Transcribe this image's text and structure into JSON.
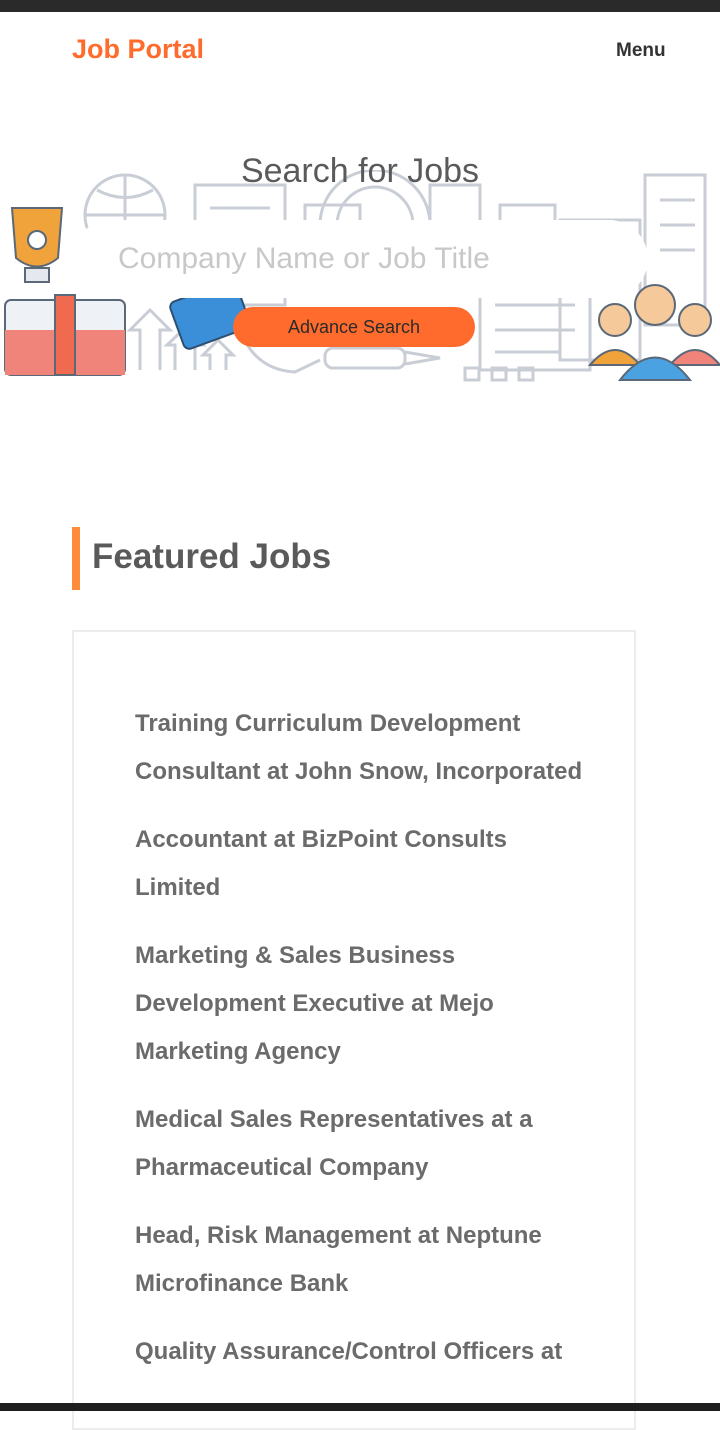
{
  "navbar": {
    "brand": "Job Portal",
    "menu_label": "Menu"
  },
  "hero": {
    "title": "Search for Jobs",
    "search_placeholder": "Company Name or Job Title",
    "advance_search_label": "Advance Search"
  },
  "featured": {
    "title": "Featured Jobs",
    "jobs": [
      "Training Curriculum Development Consultant at John Snow, Incorporated",
      "Accountant at BizPoint Consults Limited",
      "Marketing & Sales Business Development Executive at Mejo Marketing Agency",
      "Medical Sales Representatives at a Pharmaceutical Company",
      "Head, Risk Management at Neptune Microfinance Bank",
      "Quality Assurance/Control Officers at"
    ]
  },
  "colors": {
    "accent": "#ff6b2c",
    "section_bar": "#ff8c3a",
    "heading_text": "#5a5a5a",
    "job_text": "#6b6b6b"
  }
}
